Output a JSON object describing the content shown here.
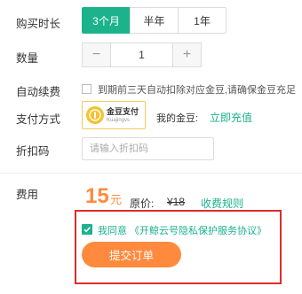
{
  "duration": {
    "label": "购买时长",
    "options": [
      "3个月",
      "半年",
      "1年"
    ],
    "selected": "3个月"
  },
  "quantity": {
    "label": "数量",
    "minus": "−",
    "plus": "+",
    "value": "1"
  },
  "auto_renew": {
    "label": "自动续费",
    "text": "到期前三天自动扣除对应金豆,请确保金豆充足"
  },
  "payment": {
    "label": "支付方式",
    "method_name": "金豆支付",
    "method_sub": "Kuajingvs",
    "coin_icon": "coin-icon",
    "gold_label": "我的金豆:",
    "recharge": "立即充值"
  },
  "discount": {
    "label": "折扣码",
    "placeholder": "请输入折扣码"
  },
  "fee": {
    "label": "费用",
    "price": "15",
    "unit": "元",
    "original_label": "原价:",
    "original_value": "¥18",
    "rule_link": "收费规则"
  },
  "agreement": {
    "text": "我同意 《开鲸云号隐私保护服务协议》",
    "checked": true
  },
  "submit_label": "提交订单",
  "colors": {
    "accent": "#1bb28c",
    "price": "#ff8a3d",
    "highlight_border": "#e02b2b"
  }
}
